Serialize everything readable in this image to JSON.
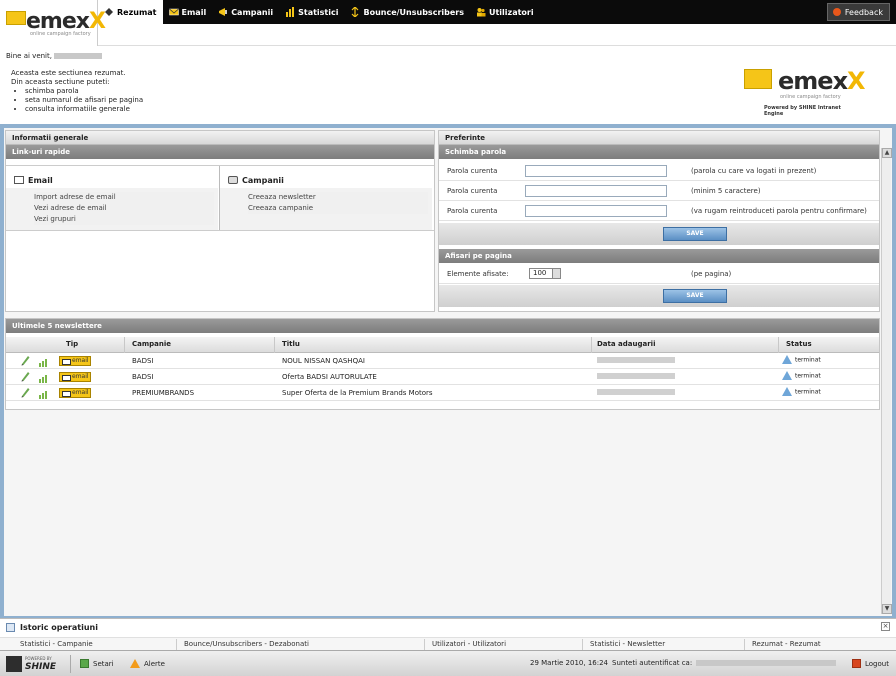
{
  "nav": {
    "logo": "emex",
    "logo_x": "X",
    "logo_sub": "online campaign factory",
    "items": [
      {
        "label": "Rezumat",
        "icon": "summary-icon"
      },
      {
        "label": "Email",
        "icon": "envelope-icon"
      },
      {
        "label": "Campanii",
        "icon": "campaign-icon"
      },
      {
        "label": "Statistici",
        "icon": "bar-chart-icon"
      },
      {
        "label": "Bounce/Unsubscribers",
        "icon": "bounce-icon"
      },
      {
        "label": "Utilizatori",
        "icon": "users-icon"
      }
    ],
    "feedback": "Feedback"
  },
  "summary": {
    "welcome": "Bine ai venit,",
    "intro": "Aceasta este sectiunea rezumat.",
    "can_do": "Din aceasta sectiune puteti:",
    "bullets": [
      "schimba parola",
      "seta numarul de afisari pe pagina",
      "consulta informatiile generale"
    ]
  },
  "brand": {
    "name": "emex",
    "name_x": "X",
    "sub": "online campaign factory",
    "powered": "Powered by SHINE Intranet Engine"
  },
  "info": {
    "title": "Informatii generale",
    "quick_links": "Link-uri rapide",
    "email": {
      "title": "Email",
      "links": [
        "Import adrese de email",
        "Vezi adrese de email",
        "Vezi grupuri"
      ]
    },
    "campaigns": {
      "title": "Campanii",
      "links": [
        "Creeaza newsletter",
        "Creeaza campanie"
      ]
    }
  },
  "prefs": {
    "title": "Preferinte",
    "change_password": "Schimba parola",
    "rows": [
      {
        "label": "Parola curenta",
        "value": "",
        "hint": "(parola cu care va logati in prezent)"
      },
      {
        "label": "Parola curenta",
        "value": "",
        "hint": "(minim 5 caractere)"
      },
      {
        "label": "Parola curenta",
        "value": "",
        "hint": "(va rugam reintroduceti parola pentru confirmare)"
      }
    ],
    "save": "SAVE",
    "per_page": "Afisari pe pagina",
    "elements_label": "Elemente afisate:",
    "elements_value": "100",
    "elements_hint": "(pe pagina)",
    "save2": "SAVE"
  },
  "newsletters": {
    "title": "Ultimele 5 newslettere",
    "headers": {
      "tip": "Tip",
      "campanie": "Campanie",
      "titlu": "Titlu",
      "data": "Data adaugarii",
      "status": "Status"
    },
    "badge": "email",
    "rows": [
      {
        "campanie": "BADSI",
        "titlu": "NOUL NISSAN QASHQAI",
        "status": "terminat"
      },
      {
        "campanie": "BADSI",
        "titlu": "Oferta BADSI AUTORULATE",
        "status": "terminat"
      },
      {
        "campanie": "PREMIUMBRANDS",
        "titlu": "Super Oferta de la Premium Brands Motors",
        "status": "terminat"
      }
    ]
  },
  "history": {
    "title": "Istoric operatiuni",
    "items": [
      "Statistici - Campanie",
      "Bounce/Unsubscribers - Dezabonati",
      "Utilizatori - Utilizatori",
      "Statistici - Newsletter",
      "Rezumat - Rezumat"
    ]
  },
  "bottom": {
    "powered_by": "POWERED BY",
    "shine": "SHINE",
    "settings": "Setari",
    "alerts": "Alerte",
    "datetime": "29 Martie 2010, 16:24",
    "auth": "Sunteti autentificat ca:",
    "logout": "Logout"
  },
  "colors": {
    "accent": "#f5c518",
    "frame": "#8fb0cf",
    "status": "#6fa6d8",
    "nav_bg": "#0b0b0b"
  }
}
